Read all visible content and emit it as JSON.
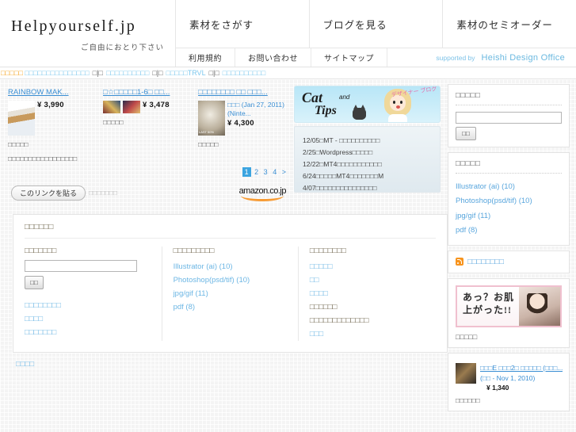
{
  "header": {
    "brand_title": "Helpyourself.jp",
    "brand_tagline": "ご自由におとり下さい",
    "nav": [
      {
        "label": "素材をさがす"
      },
      {
        "label": "ブログを見る"
      },
      {
        "label": "素材のセミオーダー"
      }
    ],
    "subnav": [
      {
        "label": "利用規約"
      },
      {
        "label": "お問い合わせ"
      },
      {
        "label": "サイトマップ"
      }
    ],
    "supported_by": "supported by",
    "supporter": "Heishi Design Office"
  },
  "ticker": {
    "label": "□□□□□",
    "items": [
      {
        "text": "□□□□□□□□□□□□□□□"
      },
      {
        "text": "□□□□□□□□□□"
      },
      {
        "text": "□□□□□TRVL"
      },
      {
        "text": "□□□□□□□□□□"
      }
    ],
    "separator": "□|□"
  },
  "products": {
    "items": [
      {
        "title": "RAINBOW MAK...",
        "meta": "",
        "price": "¥ 3,990",
        "caption": "□□□□□",
        "note": "□□□□□□□□□□□□□□□□□"
      },
      {
        "title": "□☆□□□□□1-6□ □□...",
        "meta": "",
        "price": "¥ 3,478",
        "caption": "□□□□□",
        "note": ""
      },
      {
        "title": "□□□□□□□□ □□ □□□...",
        "meta": "□□□ (Jan 27, 2011) (Ninte...",
        "price": "¥ 4,300",
        "caption": "□□□□□",
        "note": ""
      }
    ],
    "pager": {
      "pages": [
        "1",
        "2",
        "3",
        "4"
      ],
      "next": ">",
      "current": "1"
    },
    "link_button": "このリンクを貼る",
    "link_note": "□□□□□□□",
    "amazon_word": "amazon",
    "amazon_tld": ".co.jp"
  },
  "blog": {
    "banner_cat": "Cat",
    "banner_and": "and",
    "banner_tips": "Tips",
    "banner_deco": "デザイナー\nブログ",
    "entries": [
      {
        "text": "12/05□MT - □□□□□□□□□□"
      },
      {
        "text": "2/25□Wordpress□□□□□"
      },
      {
        "text": "12/22□MT4□□□□□□□□□□□"
      },
      {
        "text": "6/24□□□□□MT4□□□□□□□M"
      },
      {
        "text": "4/07□□□□□□□□□□□□□□□"
      }
    ]
  },
  "sidebar": {
    "search_title": "□□□□□",
    "search_value": "",
    "search_button": "□□",
    "category_title": "□□□□□",
    "categories": [
      {
        "label": "Illustrator (ai) (10)"
      },
      {
        "label": "Photoshop(psd/tif) (10)"
      },
      {
        "label": "jpg/gif (11)"
      },
      {
        "label": "pdf (8)"
      }
    ],
    "rss_label": "□□□□□□□□",
    "ad_title": "□□□□",
    "ad_line1": "あっ？お肌",
    "ad_line2": "上がった!!",
    "ad_caption": "□□□□□",
    "product": {
      "title": "□□□E □□□2□ □□□□□ (□□□...",
      "meta": "(□□ - Nov 1, 2010)",
      "price": "¥ 1,340",
      "caption": "□□□□□□"
    }
  },
  "footer": {
    "title": "□□□□□□",
    "col1": {
      "heading": "□□□□□□□",
      "search_value": "",
      "search_button": "□□",
      "links": [
        {
          "label": "□□□□□□□□"
        },
        {
          "label": "□□□□"
        },
        {
          "label": "□□□□□□□"
        }
      ]
    },
    "col2": {
      "heading": "□□□□□□□□□",
      "links": [
        {
          "label": "Illustrator (ai) (10)"
        },
        {
          "label": "Photoshop(psd/tif) (10)"
        },
        {
          "label": "jpg/gif (11)"
        },
        {
          "label": "pdf (8)"
        }
      ]
    },
    "col3": {
      "heading": "□□□□□□□□",
      "entries": [
        {
          "label": "□□□□□",
          "link": true
        },
        {
          "label": "□□",
          "link": true
        },
        {
          "label": "□□□□",
          "link": true
        },
        {
          "label": "□□□□□□",
          "link": false
        },
        {
          "label": "□□□□□□□□□□□□□",
          "link": false
        },
        {
          "label": "□□□",
          "link": true
        }
      ]
    }
  },
  "bottom": {
    "link": "□□□□"
  }
}
